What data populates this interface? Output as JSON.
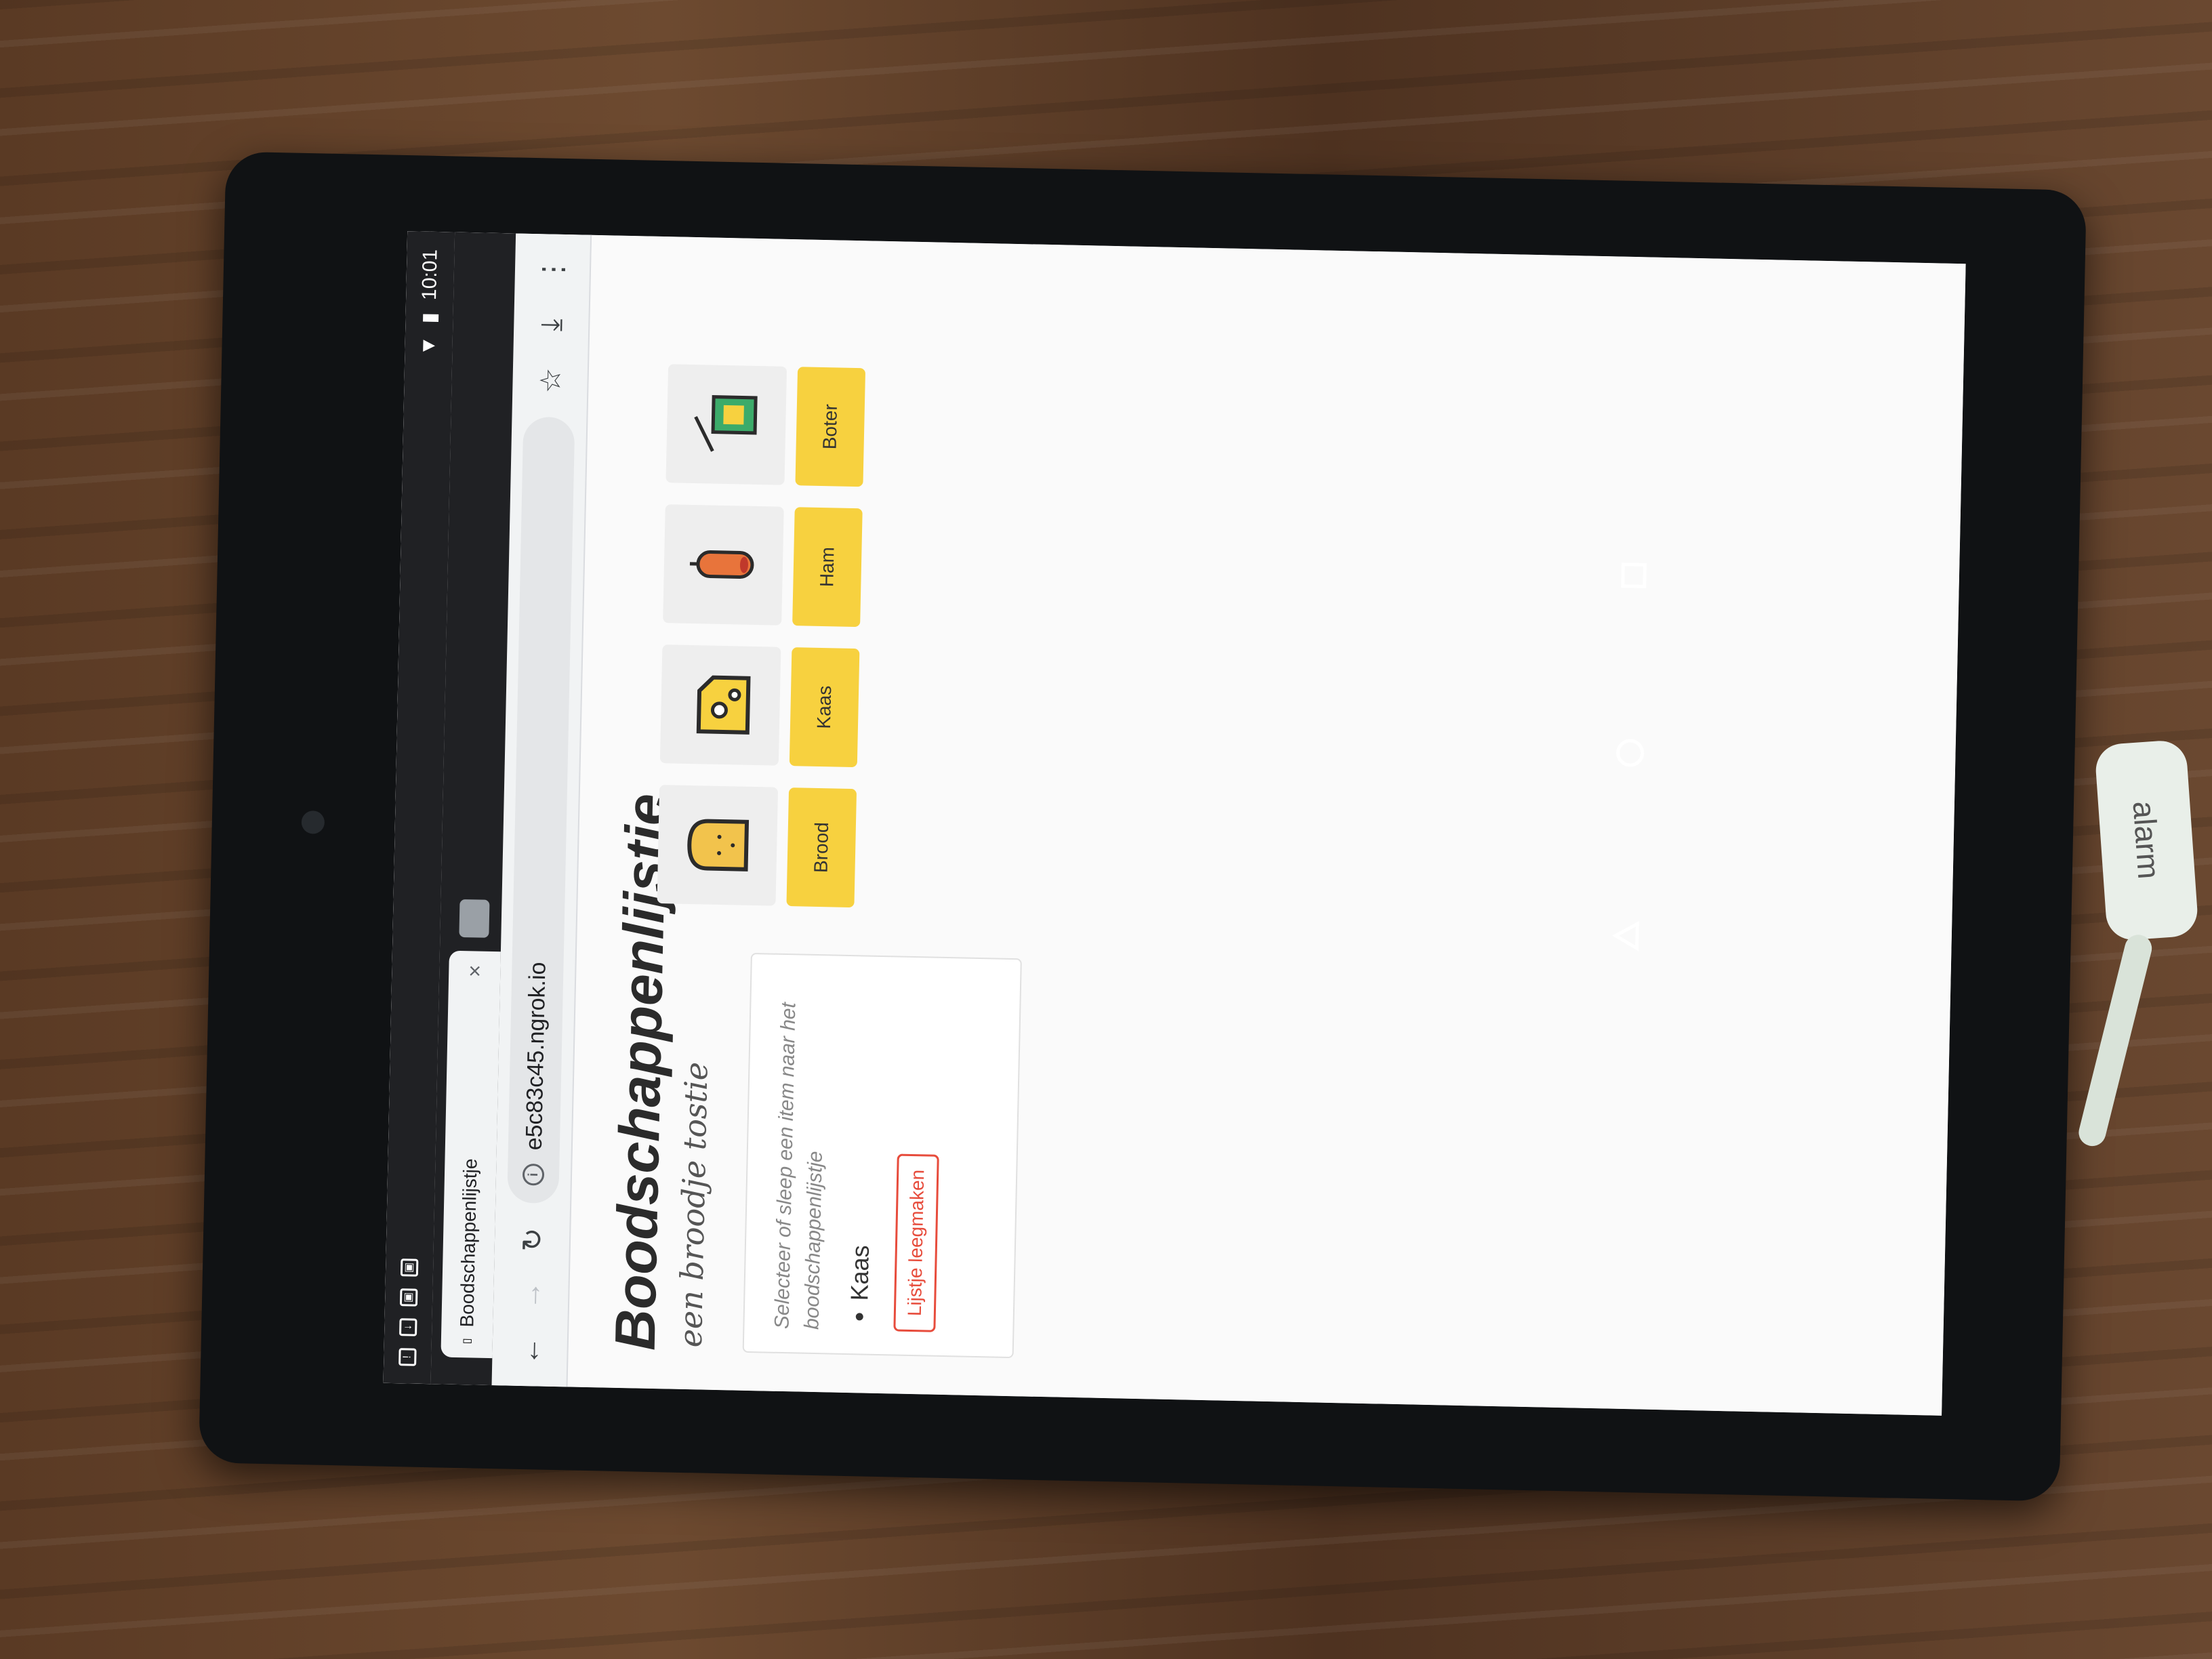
{
  "status_bar": {
    "time": "10:01"
  },
  "tab": {
    "title": "Boodschappenlijstje",
    "close": "×"
  },
  "toolbar": {
    "url": "e5c83c45.ngrok.io"
  },
  "page": {
    "title": "Boodschappenlijstje",
    "subtitle": "een broodje tostie",
    "list_hint": "Selecteer of sleep een item naar het boodschappenlijstje",
    "list_items": [
      "Kaas"
    ],
    "clear_button": "Lijstje leegmaken"
  },
  "products": [
    {
      "name": "Brood",
      "icon": "bread-icon"
    },
    {
      "name": "Kaas",
      "icon": "cheese-icon"
    },
    {
      "name": "Ham",
      "icon": "sausage-icon"
    },
    {
      "name": "Boter",
      "icon": "butter-icon"
    }
  ],
  "colors": {
    "accent": "#f7d13f",
    "danger": "#e74c3c",
    "chrome": "#202124"
  },
  "sticker": {
    "label": "alarm"
  }
}
